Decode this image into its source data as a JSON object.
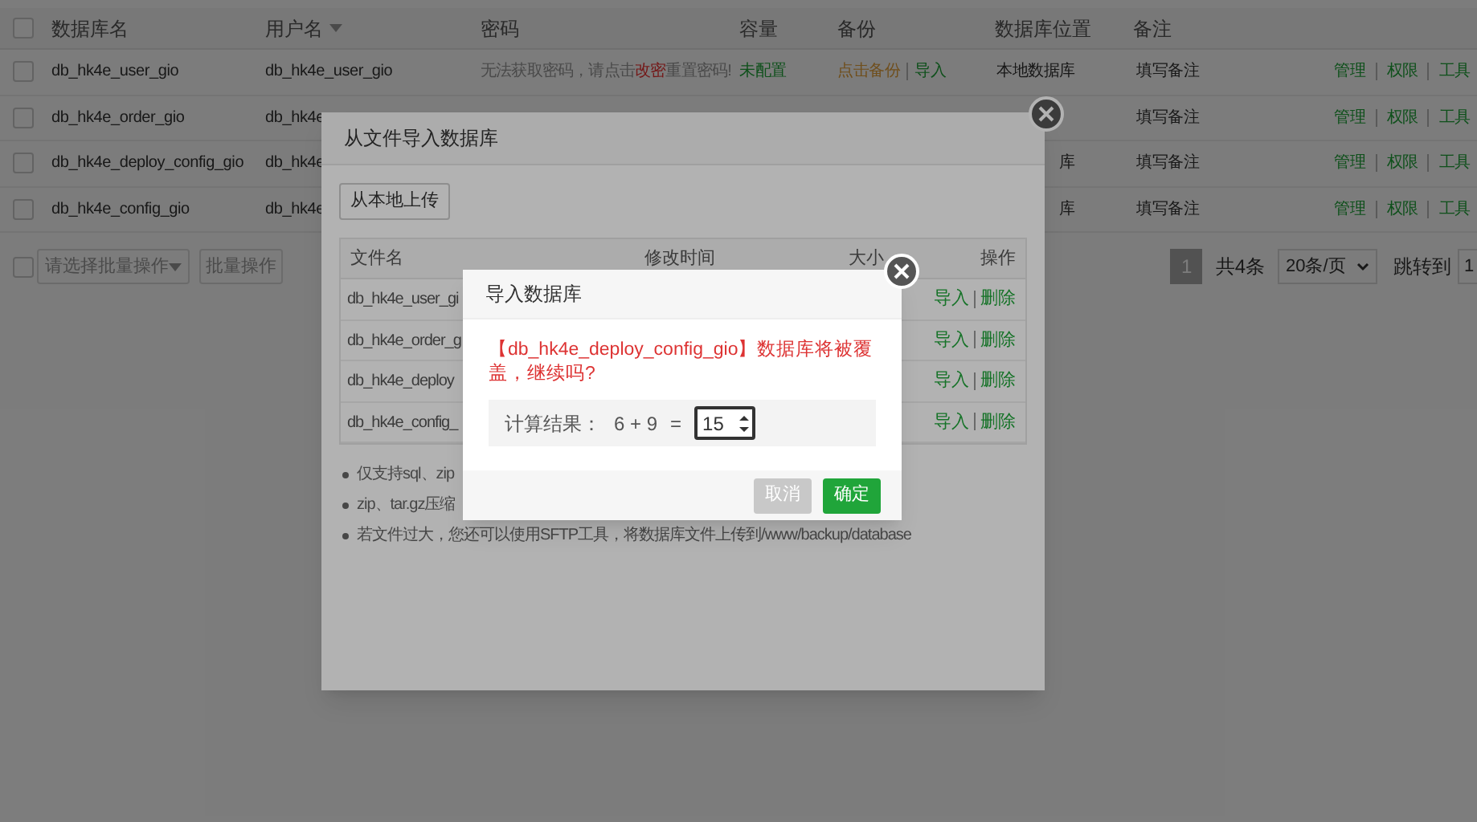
{
  "table": {
    "columns": [
      {
        "label": "数据库名",
        "sorted": false
      },
      {
        "label": "用户名",
        "sorted": true
      },
      {
        "label": "密码",
        "sorted": false
      },
      {
        "label": "容量",
        "sorted": false
      },
      {
        "label": "备份",
        "sorted": false
      },
      {
        "label": "数据库位置",
        "sorted": false
      },
      {
        "label": "备注",
        "sorted": false
      }
    ],
    "header_checked": false,
    "rows": [
      {
        "checked": false,
        "name": "db_hk4e_user_gio",
        "user": "db_hk4e_user_gio",
        "password_text": "无法获取密码，请点击",
        "password_link": "改密",
        "password_after": "重置密码!",
        "capacity": "未配置",
        "backup": "点击备份",
        "backup_import": "导入",
        "location": "本地数据库",
        "note": "填写备注",
        "actions": [
          "管理",
          "权限",
          "工具"
        ]
      },
      {
        "checked": false,
        "name": "db_hk4e_order_gio",
        "user": "db_hk4e",
        "note": "填写备注",
        "actions": [
          "管理",
          "权限",
          "工具"
        ]
      },
      {
        "checked": false,
        "name": "db_hk4e_deploy_config_gio",
        "user": "db_hk4e",
        "location": "库",
        "note": "填写备注",
        "actions": [
          "管理",
          "权限",
          "工具"
        ]
      },
      {
        "checked": false,
        "name": "db_hk4e_config_gio",
        "user": "db_hk4e",
        "location": "库",
        "note": "填写备注",
        "actions": [
          "管理",
          "权限",
          "工具"
        ]
      }
    ]
  },
  "batch": {
    "checked": false,
    "select_placeholder": "请选择批量操作",
    "button": "批量操作"
  },
  "pagination": {
    "pages": [
      {
        "label": "1",
        "selected": true
      }
    ],
    "total": "共4条",
    "page_size": "20条/页",
    "jump_label": "跳转到",
    "jump_value": "1"
  },
  "import_dialog": {
    "title": "从文件导入数据库",
    "upload_button": "从本地上传",
    "columns": [
      "文件名",
      "修改时间",
      "大小",
      "操作"
    ],
    "rows": [
      {
        "file": "db_hk4e_user_gi",
        "actions": [
          "导入",
          "删除"
        ]
      },
      {
        "file": "db_hk4e_order_g",
        "actions": [
          "导入",
          "删除"
        ]
      },
      {
        "file": "db_hk4e_deploy",
        "actions": [
          "导入",
          "删除"
        ]
      },
      {
        "file": "db_hk4e_config_",
        "actions": [
          "导入",
          "删除"
        ]
      }
    ],
    "notes": [
      "仅支持sql、zip",
      "zip、tar.gz压缩",
      "若文件过大，您还可以使用SFTP工具，将数据库文件上传到/www/backup/database"
    ]
  },
  "confirm_dialog": {
    "title": "导入数据库",
    "message": "【db_hk4e_deploy_config_gio】数据库将被覆盖，继续吗?",
    "calc_label": "计算结果：",
    "expression": "6 + 9",
    "equals": "=",
    "answer": "15",
    "buttons": [
      {
        "label": "取消",
        "kind": "cancel"
      },
      {
        "label": "确定",
        "kind": "primary"
      }
    ]
  }
}
